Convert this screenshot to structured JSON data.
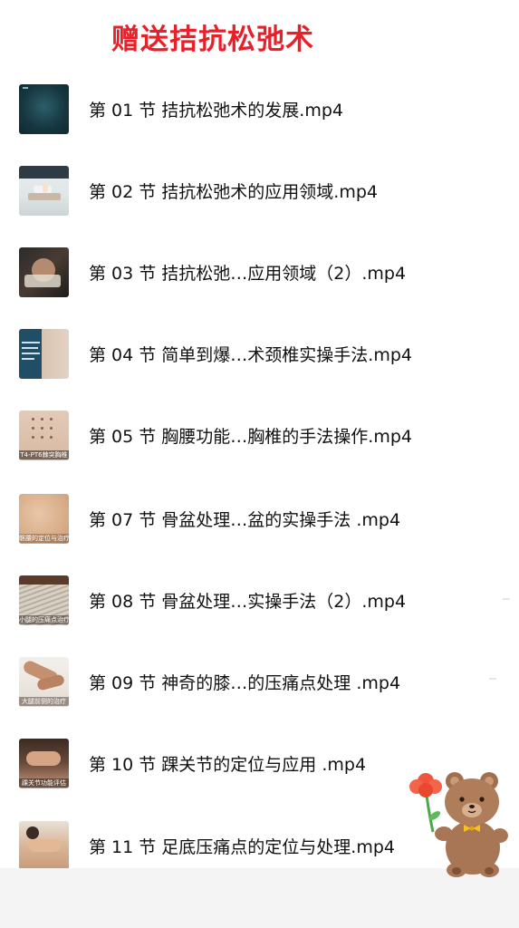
{
  "header": {
    "title": "赠送拮抗松弛术"
  },
  "files": [
    {
      "name": "第 01 节  拮抗松弛术的发展.mp4",
      "thumb_caption": "",
      "thumb_style": "dark-teal"
    },
    {
      "name": "第 02 节  拮抗松弛术的应用领域.mp4",
      "thumb_caption": "",
      "thumb_style": "light-room"
    },
    {
      "name": "第 03 节  拮抗松弛…应用领域（2）.mp4",
      "thumb_caption": "",
      "thumb_style": "dark-photo"
    },
    {
      "name": "第 04 节  简单到爆…术颈椎实操手法.mp4",
      "thumb_caption": "",
      "thumb_style": "slide"
    },
    {
      "name": "第 05 节  胸腰功能…胸椎的手法操作.mp4",
      "thumb_caption": "T4-PT6棘突胸椎",
      "thumb_style": "skin-dots"
    },
    {
      "name": "第 07 节  骨盆处理…盆的实操手法 .mp4",
      "thumb_caption": "髂腰的定位与治疗",
      "thumb_style": "skin"
    },
    {
      "name": "第 08 节  骨盆处理…实操手法（2）.mp4",
      "thumb_caption": "小腿的压痛点治疗",
      "thumb_style": "fabric"
    },
    {
      "name": "第 09 节  神奇的膝…的压痛点处理 .mp4",
      "thumb_caption": "大腿前侧的治疗",
      "thumb_style": "knee"
    },
    {
      "name": "第 10 节  踝关节的定位与应用 .mp4",
      "thumb_caption": "踝关节功能评估",
      "thumb_style": "ankle"
    },
    {
      "name": "第 11 节  足底压痛点的定位与处理.mp4",
      "thumb_caption": "",
      "thumb_style": "foot"
    }
  ],
  "decoration": {
    "sticker": "bear-holding-flower"
  }
}
